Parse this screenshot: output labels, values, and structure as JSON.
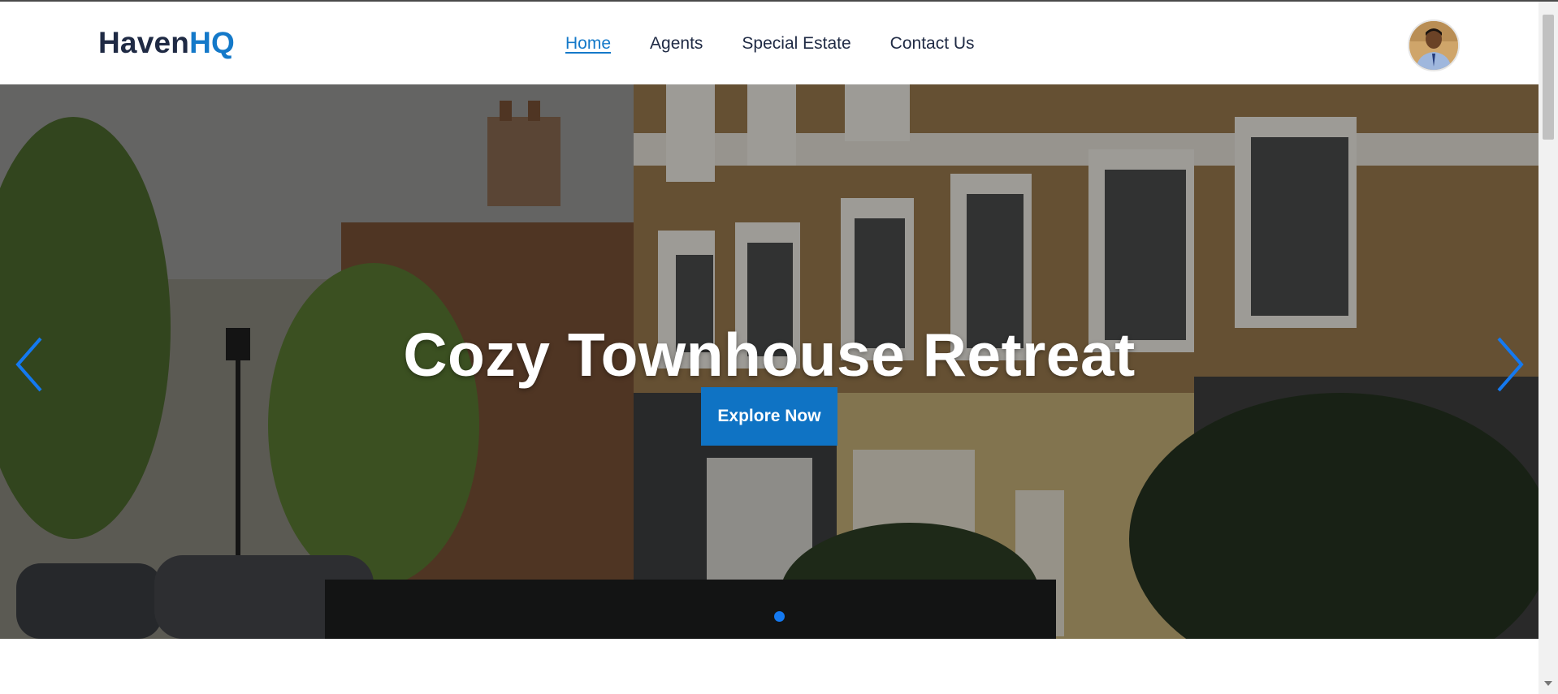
{
  "brand": {
    "name_part1": "Haven",
    "name_part2": "HQ"
  },
  "nav": {
    "items": [
      {
        "label": "Home",
        "active": true
      },
      {
        "label": "Agents",
        "active": false
      },
      {
        "label": "Special Estate",
        "active": false
      },
      {
        "label": "Contact Us",
        "active": false
      }
    ]
  },
  "hero": {
    "title": "Cozy Townhouse Retreat",
    "cta_label": "Explore Now",
    "slide_count": 1,
    "active_slide": 0,
    "icons": {
      "prev": "chevron-left-icon",
      "next": "chevron-right-icon"
    }
  },
  "colors": {
    "accent": "#1479c9",
    "brand_dark": "#1f2a44",
    "button": "#0f73c4",
    "dot_active": "#1479f0"
  }
}
